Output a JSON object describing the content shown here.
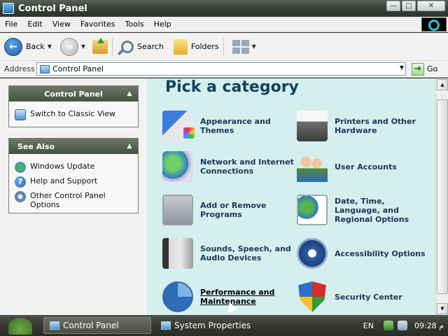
{
  "window": {
    "title": "Control Panel"
  },
  "menu": [
    "File",
    "Edit",
    "View",
    "Favorites",
    "Tools",
    "Help"
  ],
  "toolbar": {
    "back": "Back",
    "search": "Search",
    "folders": "Folders"
  },
  "address": {
    "label": "Address",
    "value": "Control Panel",
    "go": "Go"
  },
  "left": {
    "cp_panel": {
      "title": "Control Panel",
      "task": "Switch to Classic View"
    },
    "see_also": {
      "title": "See Also",
      "items": [
        "Windows Update",
        "Help and Support",
        "Other Control Panel Options"
      ]
    }
  },
  "content": {
    "heading": "Pick a category",
    "categories": [
      {
        "name": "Appearance and Themes",
        "icon": "appearance-icon"
      },
      {
        "name": "Printers and Other Hardware",
        "icon": "printer-icon"
      },
      {
        "name": "Network and Internet Connections",
        "icon": "network-icon"
      },
      {
        "name": "User Accounts",
        "icon": "users-icon"
      },
      {
        "name": "Add or Remove Programs",
        "icon": "add-remove-icon"
      },
      {
        "name": "Date, Time, Language, and Regional Options",
        "icon": "date-time-icon"
      },
      {
        "name": "Sounds, Speech, and Audio Devices",
        "icon": "sounds-icon"
      },
      {
        "name": "Accessibility Options",
        "icon": "accessibility-icon"
      },
      {
        "name": "Performance and Maintenance",
        "icon": "performance-icon"
      },
      {
        "name": "Security Center",
        "icon": "security-shield-icon"
      }
    ]
  },
  "taskbar": {
    "items": [
      "Control Panel",
      "System Properties"
    ],
    "lang": "EN",
    "clock": "09:28 م"
  }
}
